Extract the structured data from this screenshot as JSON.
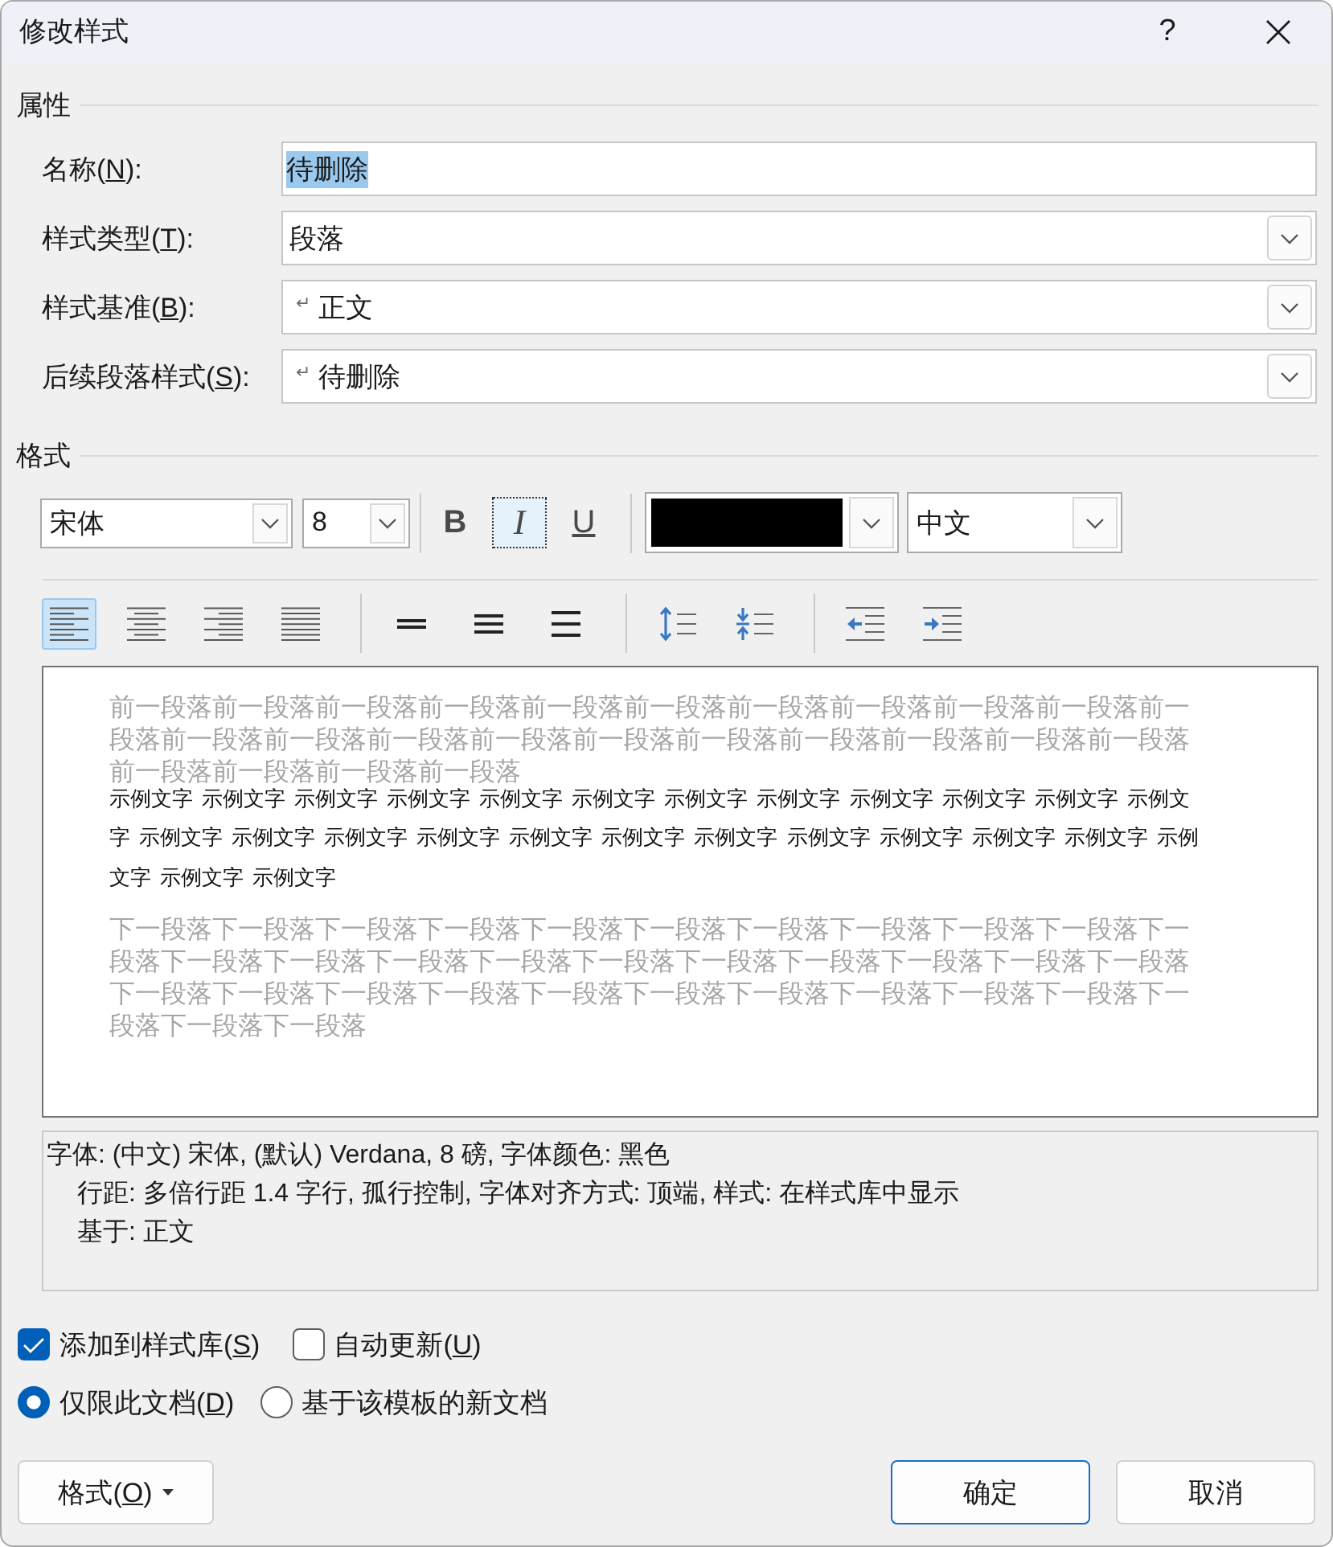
{
  "window": {
    "title": "修改样式",
    "help": "?"
  },
  "properties": {
    "heading": "属性",
    "rows": [
      {
        "kind": "text",
        "label": {
          "pre": "名称(",
          "key": "N",
          "post": "):"
        },
        "value": "待删除",
        "text_selected": true
      },
      {
        "kind": "dropdown",
        "label": {
          "pre": "样式类型(",
          "key": "T",
          "post": "):"
        },
        "value": "段落"
      },
      {
        "kind": "dropdown",
        "label": {
          "pre": "样式基准(",
          "key": "B",
          "post": "):"
        },
        "mark": "↵",
        "value": "正文"
      },
      {
        "kind": "dropdown",
        "label": {
          "pre": "后续段落样式(",
          "key": "S",
          "post": "):"
        },
        "mark": "↵",
        "value": "待删除"
      }
    ]
  },
  "format": {
    "heading": "格式",
    "font": {
      "value": "宋体"
    },
    "size": {
      "value": "8"
    },
    "styles": [
      {
        "kind": "bold",
        "label": "B",
        "selected": false,
        "focused": false
      },
      {
        "kind": "italic",
        "label": "I",
        "selected": false,
        "focused": true
      },
      {
        "kind": "underline",
        "label": "U",
        "selected": false,
        "focused": false
      }
    ],
    "font_color": {
      "color": "#000000"
    },
    "language": {
      "value": "中文"
    },
    "alignment": [
      {
        "kind": "left",
        "selected": true
      },
      {
        "kind": "center",
        "selected": false
      },
      {
        "kind": "right",
        "selected": false
      },
      {
        "kind": "justify",
        "selected": false
      }
    ],
    "line_spacing": [
      {
        "kind": "single",
        "selected": false
      },
      {
        "kind": "one_half",
        "selected": false
      },
      {
        "kind": "double",
        "selected": false
      }
    ],
    "paragraph_spacing": [
      {
        "kind": "increase"
      },
      {
        "kind": "decrease"
      }
    ],
    "indent": [
      {
        "kind": "decrease"
      },
      {
        "kind": "increase"
      }
    ]
  },
  "preview": {
    "previous_paragraph": "前一段落前一段落前一段落前一段落前一段落前一段落前一段落前一段落前一段落前一段落前一段落前一段落前一段落前一段落前一段落前一段落前一段落前一段落前一段落前一段落前一段落前一段落前一段落前一段落前一段落",
    "sample_text": "示例文字 示例文字 示例文字 示例文字 示例文字 示例文字 示例文字 示例文字 示例文字 示例文字 示例文字 示例文字 示例文字 示例文字 示例文字 示例文字 示例文字 示例文字 示例文字 示例文字 示例文字 示例文字 示例文字 示例文字 示例文字 示例文字",
    "next_paragraph": "下一段落下一段落下一段落下一段落下一段落下一段落下一段落下一段落下一段落下一段落下一段落下一段落下一段落下一段落下一段落下一段落下一段落下一段落下一段落下一段落下一段落下一段落下一段落下一段落下一段落下一段落下一段落下一段落下一段落下一段落下一段落下一段落下一段落下一段落"
  },
  "description": {
    "lines": [
      "字体: (中文) 宋体, (默认) Verdana, 8 磅, 字体颜色: 黑色",
      "行距: 多倍行距 1.4 字行, 孤行控制, 字体对齐方式: 顶端, 样式: 在样式库中显示",
      "基于: 正文"
    ]
  },
  "options": {
    "checkboxes": [
      {
        "label": {
          "pre": "添加到样式库(",
          "key": "S",
          "post": ")"
        },
        "checked": true
      },
      {
        "label": {
          "pre": "自动更新(",
          "key": "U",
          "post": ")"
        },
        "checked": false
      }
    ],
    "radios": [
      {
        "label": {
          "pre": "仅限此文档(",
          "key": "D",
          "post": ")"
        },
        "selected": true
      },
      {
        "label": {
          "pre": "基于该模板的新文档"
        },
        "selected": false
      }
    ]
  },
  "buttons": [
    {
      "kind": "menu",
      "label": {
        "pre": "格式(",
        "key": "O",
        "post": ")"
      }
    },
    {
      "kind": "default",
      "label": {
        "pre": "确定"
      }
    },
    {
      "kind": "normal",
      "label": {
        "pre": "取消"
      }
    }
  ]
}
